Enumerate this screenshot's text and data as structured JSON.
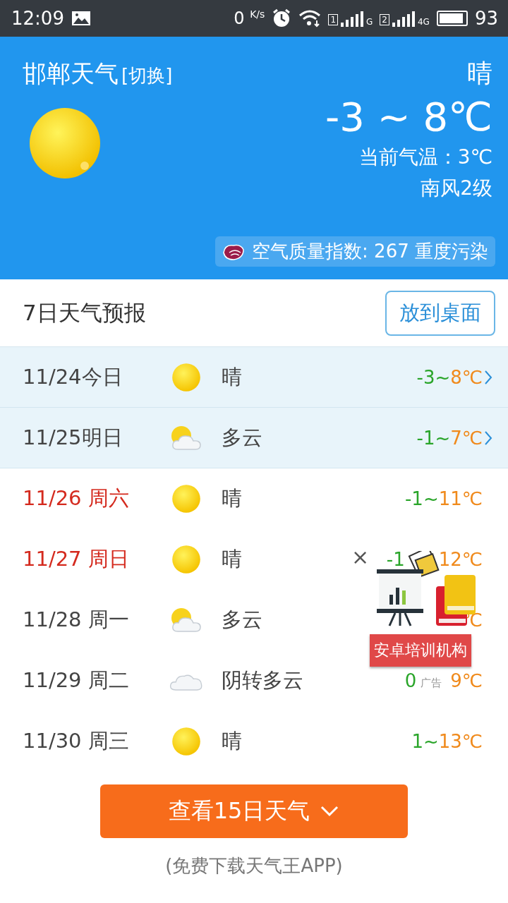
{
  "status_bar": {
    "time": "12:09",
    "speed": "0",
    "speed_unit": "K/s",
    "battery": "93",
    "sims": [
      {
        "slot": "1",
        "network": "G"
      },
      {
        "slot": "2",
        "network": "4G"
      }
    ]
  },
  "header": {
    "city": "邯郸天气",
    "switch": "[切换]",
    "condition": "晴",
    "temp_range": "-3 ~ 8℃",
    "current_temp": "当前气温：3℃",
    "wind": "南风2级",
    "aqi": "空气质量指数: 267 重度污染"
  },
  "forecast": {
    "title": "7日天气预报",
    "pin_button": "放到桌面",
    "rows": [
      {
        "date": "11/24今日",
        "weekend": false,
        "has_details": true,
        "kind": "sunny",
        "condition": "晴",
        "temp": [
          {
            "kind": "low",
            "text": "-3~",
            "color": "#2aa52a"
          },
          {
            "kind": "high",
            "text": "8℃",
            "color": "#f08a1c"
          }
        ]
      },
      {
        "date": "11/25明日",
        "weekend": false,
        "has_details": true,
        "kind": "partly_cloudy",
        "condition": "多云",
        "temp": [
          {
            "kind": "low",
            "text": "-1~",
            "color": "#2aa52a"
          },
          {
            "kind": "high",
            "text": "7℃",
            "color": "#f08a1c"
          }
        ]
      },
      {
        "date": "11/26 周六",
        "weekend": true,
        "has_details": false,
        "kind": "sunny",
        "condition": "晴",
        "temp": [
          {
            "kind": "low",
            "text": "-1~",
            "color": "#2aa52a"
          },
          {
            "kind": "high",
            "text": "11℃",
            "color": "#f08a1c"
          }
        ]
      },
      {
        "date": "11/27 周日",
        "weekend": true,
        "has_details": false,
        "kind": "sunny",
        "condition": "晴",
        "temp": [
          {
            "kind": "low",
            "text": "-1",
            "color": "#2aa52a"
          },
          {
            "kind": "high",
            "text": "12℃",
            "color": "#f08a1c"
          }
        ]
      },
      {
        "date": "11/28 周一",
        "weekend": false,
        "has_details": false,
        "kind": "partly_cloudy",
        "condition": "多云",
        "temp": [
          {
            "kind": "high",
            "text": "℃",
            "color": "#f08a1c"
          }
        ]
      },
      {
        "date": "11/29 周二",
        "weekend": false,
        "has_details": false,
        "kind": "cloudy",
        "condition": "阴转多云",
        "temp": [
          {
            "kind": "low",
            "text": "0",
            "color": "#2aa52a"
          },
          {
            "kind": "high",
            "text": "9℃",
            "color": "#f08a1c"
          }
        ]
      },
      {
        "date": "11/30 周三",
        "weekend": false,
        "has_details": false,
        "kind": "sunny",
        "condition": "晴",
        "temp": [
          {
            "kind": "low",
            "text": "1~",
            "color": "#2aa52a"
          },
          {
            "kind": "high",
            "text": "13℃",
            "color": "#f08a1c"
          }
        ]
      }
    ]
  },
  "ad": {
    "close": "×",
    "label": "安卓培训机构",
    "tag": "广告"
  },
  "more_button": "查看15日天气",
  "footer_note": "(免费下载天气王APP)"
}
